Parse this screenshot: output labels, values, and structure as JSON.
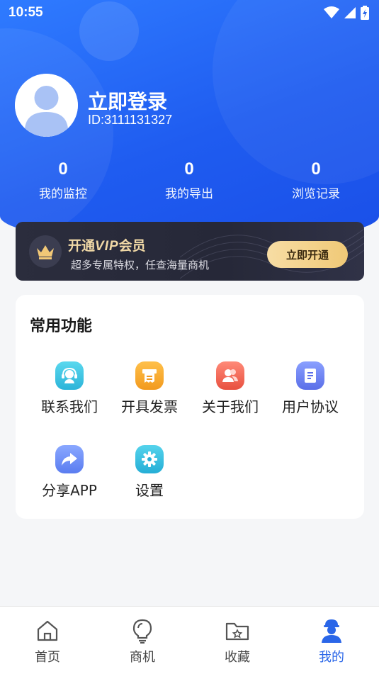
{
  "status_bar": {
    "time": "10:55"
  },
  "profile": {
    "title": "立即登录",
    "id": "ID:3111131327"
  },
  "stats": [
    {
      "value": "0",
      "label": "我的监控"
    },
    {
      "value": "0",
      "label": "我的导出"
    },
    {
      "value": "0",
      "label": "浏览记录"
    }
  ],
  "vip": {
    "title_prefix": "开通",
    "title_vip": "VIP",
    "title_suffix": "会员",
    "subtitle": "超多专属特权，任查海量商机",
    "button": "立即开通"
  },
  "functions": {
    "title": "常用功能",
    "items": [
      {
        "label": "联系我们",
        "icon": "customer-service-icon",
        "color": "#3cc5e0"
      },
      {
        "label": "开具发票",
        "icon": "invoice-icon",
        "color": "#f5a623"
      },
      {
        "label": "关于我们",
        "icon": "users-icon",
        "color": "#f26a5e"
      },
      {
        "label": "用户协议",
        "icon": "document-icon",
        "color": "#6a7ef5"
      },
      {
        "label": "分享APP",
        "icon": "share-icon",
        "color": "#6a8bf5"
      },
      {
        "label": "设置",
        "icon": "gear-icon",
        "color": "#35bfe0"
      }
    ]
  },
  "tabbar": [
    {
      "label": "首页",
      "icon": "home-icon"
    },
    {
      "label": "商机",
      "icon": "lightbulb-icon"
    },
    {
      "label": "收藏",
      "icon": "folder-icon"
    },
    {
      "label": "我的",
      "icon": "profile-icon",
      "active": true
    }
  ],
  "colors": {
    "primary": "#2a66e8",
    "vip_gold": "#f1d9a6"
  }
}
